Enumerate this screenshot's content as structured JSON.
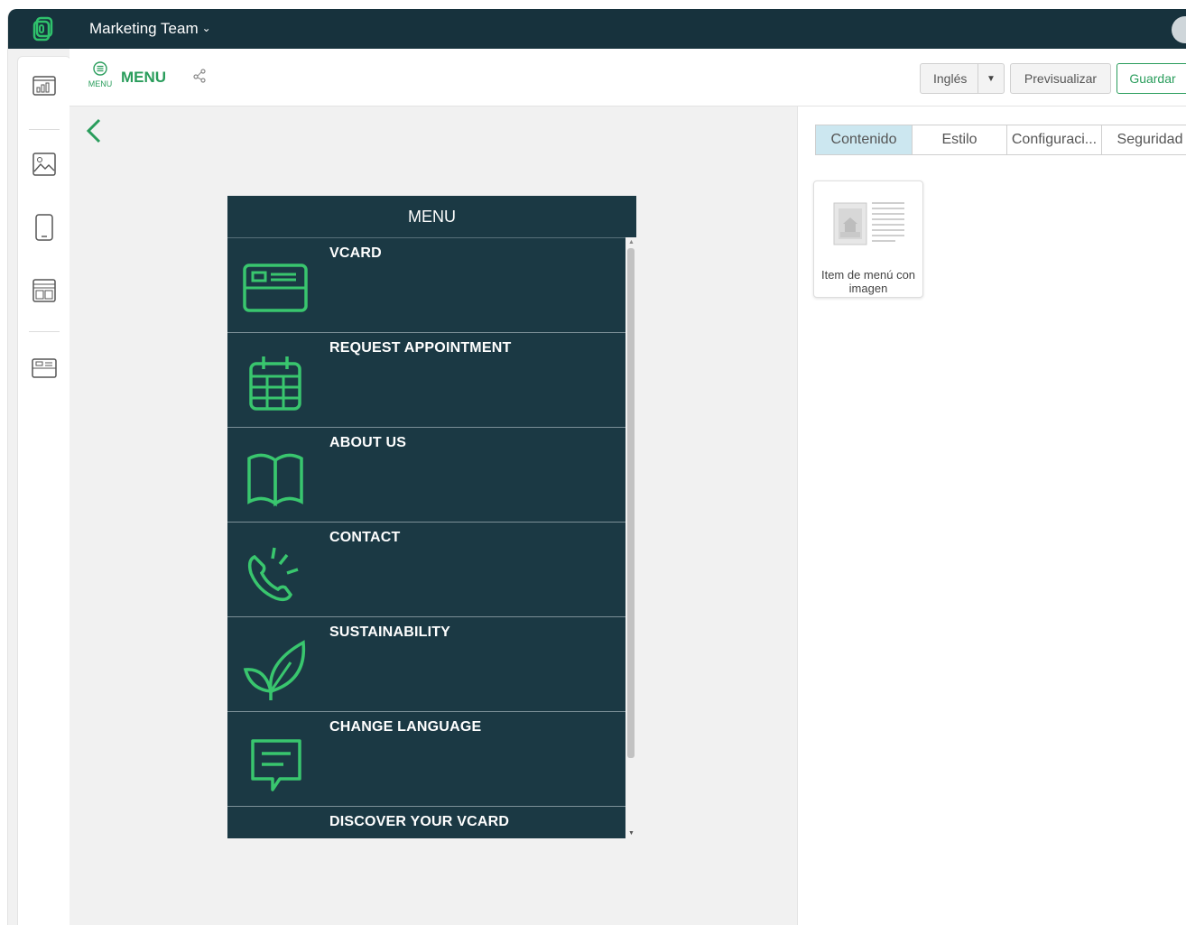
{
  "topbar": {
    "team_name": "Marketing Team"
  },
  "header": {
    "icon_caption": "MENU",
    "title": "MENU",
    "language_label": "Inglés",
    "preview_label": "Previsualizar",
    "save_label": "Guardar"
  },
  "phone": {
    "header": "MENU",
    "items": [
      {
        "label": "VCARD",
        "icon": "vcard-icon"
      },
      {
        "label": "REQUEST APPOINTMENT",
        "icon": "calendar-icon"
      },
      {
        "label": "ABOUT US",
        "icon": "book-icon"
      },
      {
        "label": "CONTACT",
        "icon": "phone-icon"
      },
      {
        "label": "SUSTAINABILITY",
        "icon": "leaf-icon"
      },
      {
        "label": "CHANGE LANGUAGE",
        "icon": "chat-icon"
      },
      {
        "label": "DISCOVER YOUR VCARD",
        "icon": "search-icon"
      }
    ]
  },
  "panel": {
    "tabs": [
      "Contenido",
      "Estilo",
      "Configuraci...",
      "Seguridad"
    ],
    "widget_label": "Item de menú con imagen"
  },
  "colors": {
    "brand_dark": "#17323d",
    "accent_green": "#2a9d5c",
    "menu_bg": "#1b3944",
    "tab_active": "#cce7f0"
  }
}
